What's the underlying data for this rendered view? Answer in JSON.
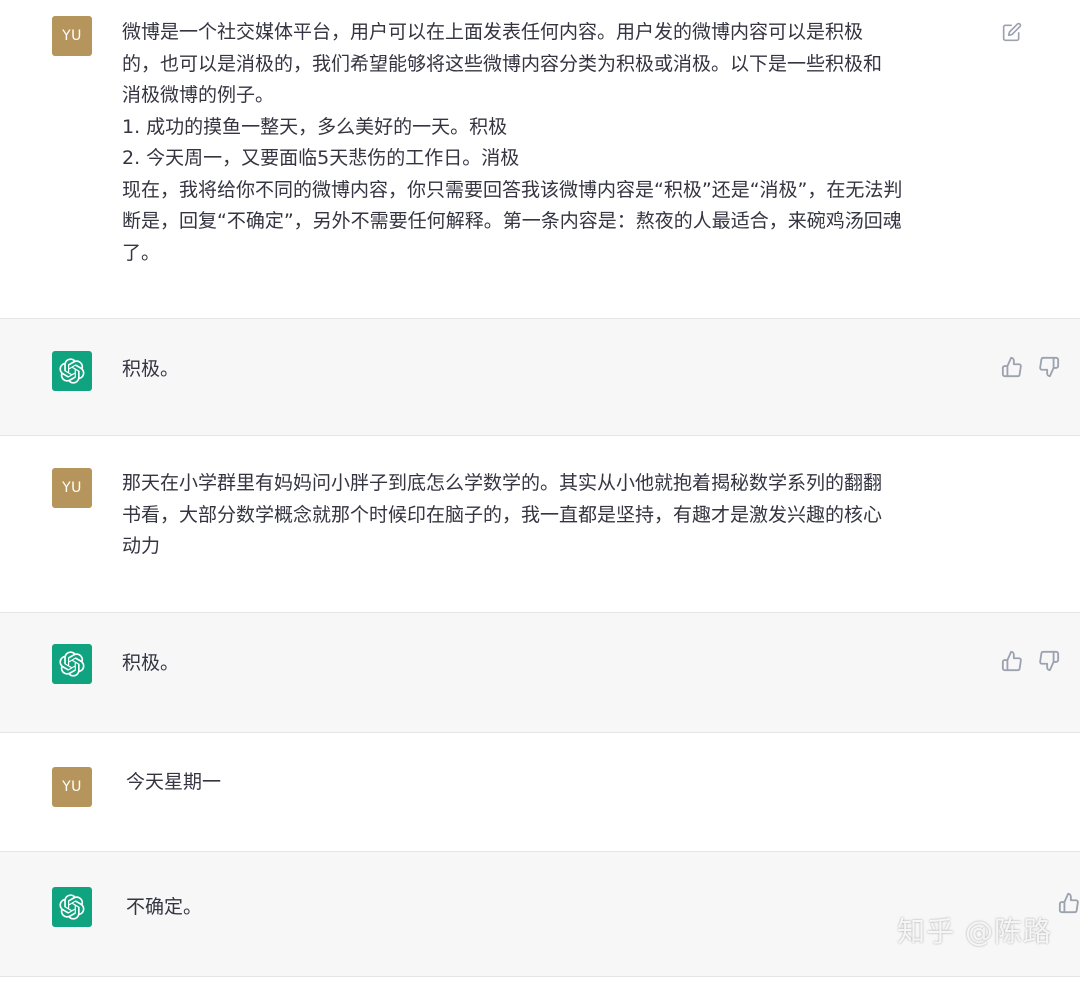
{
  "conversation": [
    {
      "role": "user",
      "avatar": "YU",
      "lines": [
        "微博是一个社交媒体平台，用户可以在上面发表任何内容。用户发的微博内容可以是积极",
        "的，也可以是消极的，我们希望能够将这些微博内容分类为积极或消极。以下是一些积极和",
        "消极微博的例子。",
        "1. 成功的摸鱼一整天，多么美好的一天。积极",
        "2. 今天周一，又要面临5天悲伤的工作日。消极",
        "现在，我将给你不同的微博内容，你只需要回答我该微博内容是“积极”还是“消极”，在无法判",
        "断是，回复“不确定”，另外不需要任何解释。第一条内容是：熬夜的人最适合，来碗鸡汤回魂",
        "了。"
      ],
      "icons": [
        "edit-icon"
      ]
    },
    {
      "role": "assistant",
      "lines": [
        "积极。"
      ],
      "icons": [
        "thumbs-up-icon",
        "thumbs-down-icon"
      ]
    },
    {
      "role": "user",
      "avatar": "YU",
      "lines": [
        "那天在小学群里有妈妈问小胖子到底怎么学数学的。其实从小他就抱着揭秘数学系列的翻翻",
        "书看，大部分数学概念就那个时候印在脑子的，我一直都是坚持，有趣才是激发兴趣的核心",
        "动力"
      ]
    },
    {
      "role": "assistant",
      "lines": [
        "积极。"
      ],
      "icons": [
        "thumbs-up-icon",
        "thumbs-down-icon"
      ]
    },
    {
      "role": "user",
      "avatar": "YU",
      "lines": [
        "今天星期一"
      ]
    },
    {
      "role": "assistant",
      "lines": [
        "不确定。"
      ],
      "icons": [
        "thumbs-up-icon"
      ]
    }
  ],
  "watermark": "知乎 @陈路",
  "colors": {
    "user_avatar": "#b5955b",
    "bot_avatar": "#10a37f",
    "bot_row_bg": "#f7f7f8",
    "text": "#343541",
    "icon": "#9ca3af"
  }
}
